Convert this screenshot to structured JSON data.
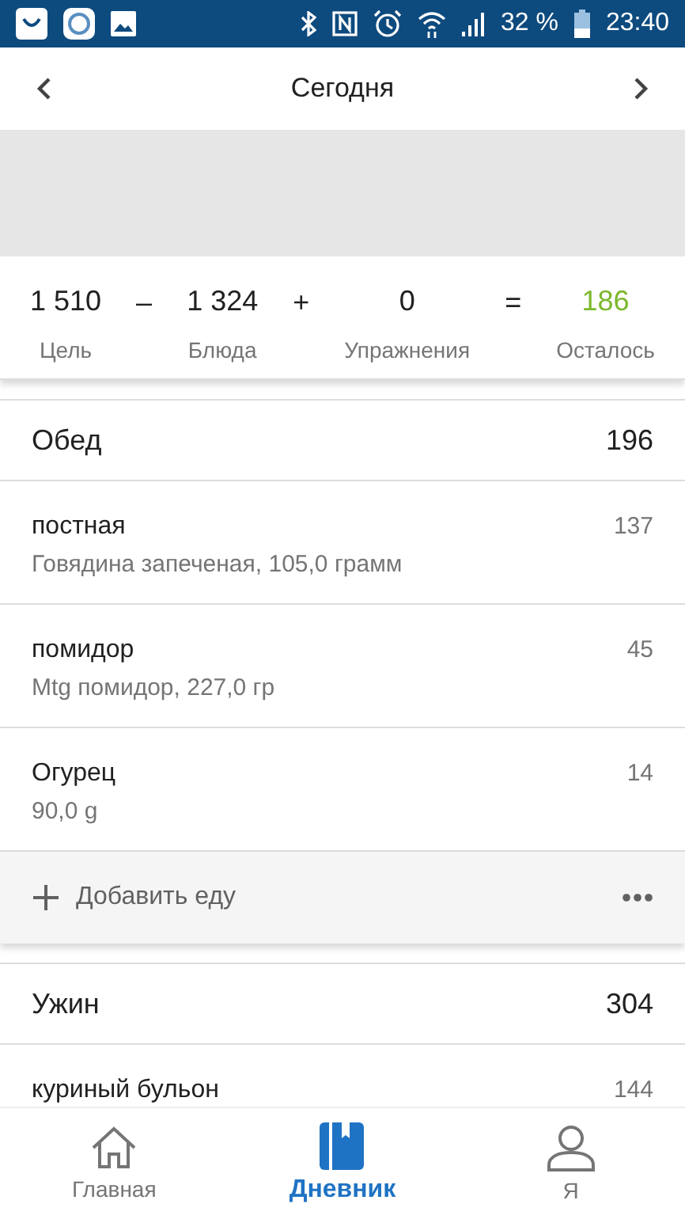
{
  "status_bar": {
    "battery_text": "32 %",
    "time": "23:40"
  },
  "header": {
    "title": "Сегодня"
  },
  "summary": [
    {
      "kind": "value",
      "value": "1 510",
      "label": "Цель",
      "color": "#212121"
    },
    {
      "kind": "operator",
      "value": "–"
    },
    {
      "kind": "value",
      "value": "1 324",
      "label": "Блюда",
      "color": "#212121"
    },
    {
      "kind": "operator",
      "value": "+"
    },
    {
      "kind": "value",
      "value": "0",
      "label": "Упражнения",
      "color": "#212121"
    },
    {
      "kind": "operator",
      "value": "="
    },
    {
      "kind": "value",
      "value": "186",
      "label": "Осталось",
      "color": "#7cb82f"
    }
  ],
  "meals": [
    {
      "name": "Обед",
      "calories": "196",
      "items": [
        {
          "name": "постная",
          "detail": "Говядина запеченая, 105,0 грамм",
          "calories": "137"
        },
        {
          "name": "помидор",
          "detail": "Mtg помидор, 227,0 гр",
          "calories": "45"
        },
        {
          "name": "Огурец",
          "detail": "90,0 g",
          "calories": "14"
        }
      ],
      "add_label": "Добавить еду"
    },
    {
      "name": "Ужин",
      "calories": "304",
      "items": [
        {
          "name": "куриный бульон",
          "calories": "144"
        }
      ]
    }
  ],
  "bottom_nav": [
    {
      "label": "Главная",
      "kind": "home",
      "selected": false
    },
    {
      "label": "Дневник",
      "kind": "diary",
      "selected": true
    },
    {
      "label": "Я",
      "kind": "profile",
      "selected": false
    }
  ]
}
